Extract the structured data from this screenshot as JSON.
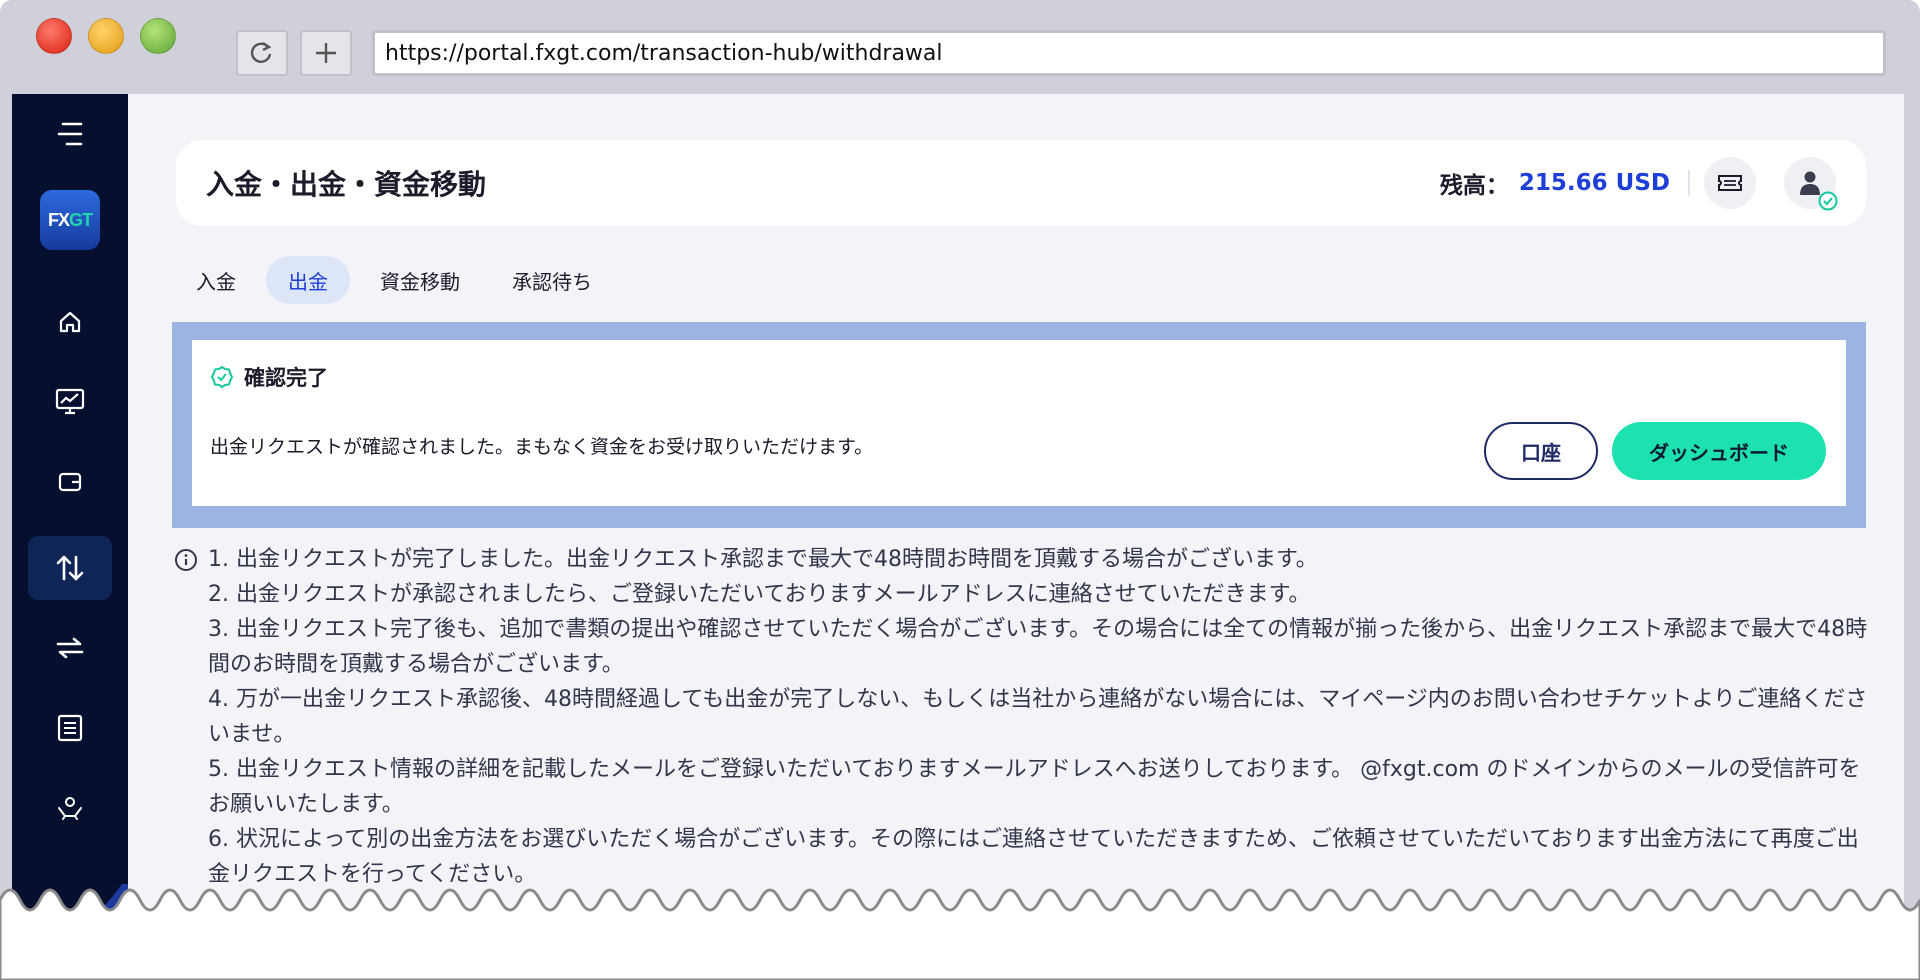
{
  "browser": {
    "url": "https://portal.fxgt.com/transaction-hub/withdrawal"
  },
  "sidebar": {
    "logo_fx": "FX",
    "logo_gt": "GT",
    "items": [
      {
        "icon": "menu-icon"
      },
      {
        "icon": "home-icon"
      },
      {
        "icon": "chart-monitor-icon"
      },
      {
        "icon": "wallet-icon"
      },
      {
        "icon": "transfer-vertical-icon",
        "active": true
      },
      {
        "icon": "transfer-horizontal-icon"
      },
      {
        "icon": "list-icon"
      },
      {
        "icon": "partner-icon"
      }
    ]
  },
  "header": {
    "title": "入金・出金・資金移動",
    "balance_label": "残高：",
    "balance_value": "215.66 USD"
  },
  "tabs": [
    {
      "label": "入金",
      "active": false
    },
    {
      "label": "出金",
      "active": true
    },
    {
      "label": "資金移動",
      "active": false
    },
    {
      "label": "承認待ち",
      "active": false
    }
  ],
  "confirmation": {
    "title": "確認完了",
    "message": "出金リクエストが確認されました。まもなく資金をお受け取りいただけます。",
    "account_button": "口座",
    "dashboard_button": "ダッシュボード"
  },
  "notes": [
    "1. 出金リクエストが完了しました。出金リクエスト承認まで最大で48時間お時間を頂戴する場合がございます。",
    "2. 出金リクエストが承認されましたら、ご登録いただいておりますメールアドレスに連絡させていただきます。",
    "3. 出金リクエスト完了後も、追加で書類の提出や確認させていただく場合がございます。その場合には全ての情報が揃った後から、出金リクエスト承認まで最大で48時間のお時間を頂戴する場合がございます。",
    "4. 万が一出金リクエスト承認後、48時間経過しても出金が完了しない、もしくは当社から連絡がない場合には、マイページ内のお問い合わせチケットよりご連絡くださいませ。",
    "5. 出金リクエスト情報の詳細を記載したメールをご登録いただいておりますメールアドレスへお送りしております。 @fxgt.com のドメインからのメールの受信許可をお願いいたします。",
    "6. 状況によって別の出金方法をお選びいただく場合がございます。その際にはご連絡させていただきますため、ご依頼させていただいております出金方法にて再度ご出金リクエストを行ってください。"
  ],
  "colors": {
    "sidebar": "#06102e",
    "accent_blue": "#1d3fd8",
    "accent_green": "#1ee1b0",
    "highlight": "#9cb4e2"
  }
}
